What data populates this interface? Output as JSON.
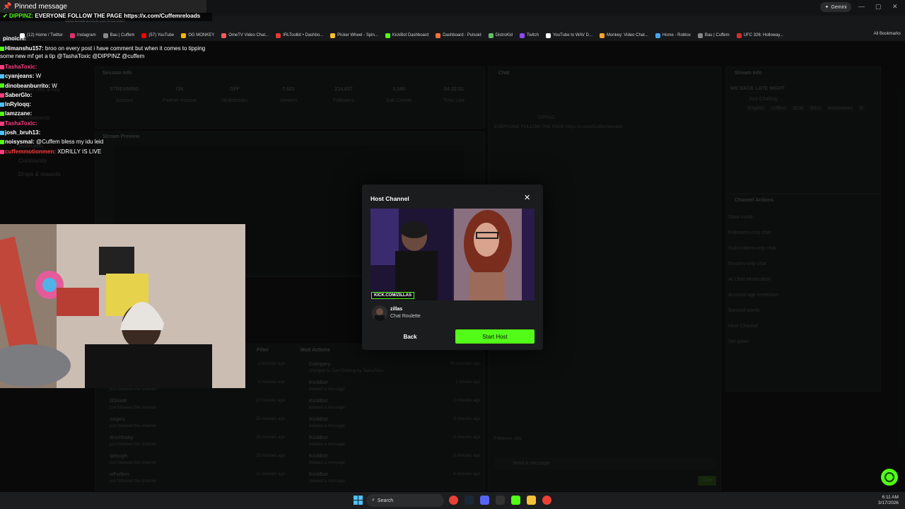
{
  "pinned": {
    "header": "Pinned message",
    "user": "DIPPINZ:",
    "text": "EVERYONE FOLLOW THE PAGE https://x.com/Cuffemreloads"
  },
  "browser": {
    "url": "dashboard.kick.com/stream",
    "gemini": "Gemini",
    "all_bookmarks": "All Bookmarks",
    "bookmarks": [
      {
        "label": "(12) Home / Twitter",
        "color": "#ffffff"
      },
      {
        "label": "Instagram",
        "color": "#e1306c"
      },
      {
        "label": "Bau | Cuffem",
        "color": "#888888"
      },
      {
        "label": "(57) YouTube",
        "color": "#ff0000"
      },
      {
        "label": "OG MONKEY",
        "color": "#ffb300"
      },
      {
        "label": "OmeTV Video Chat...",
        "color": "#ff5a5a"
      },
      {
        "label": "IRLToolkit • Dashbo...",
        "color": "#e53935"
      },
      {
        "label": "Picker Wheel - Spin...",
        "color": "#fbc02d"
      },
      {
        "label": "KickBot Dashboard",
        "color": "#53fc18"
      },
      {
        "label": "Dashboard - Pulsoid",
        "color": "#ff7043"
      },
      {
        "label": "DistroKid",
        "color": "#66bb6a"
      },
      {
        "label": "Twitch",
        "color": "#9146ff"
      },
      {
        "label": "YouTube to WAV D...",
        "color": "#ffffff"
      },
      {
        "label": "Monkey: Video Chat...",
        "color": "#ffa726"
      },
      {
        "label": "Home - Roblox",
        "color": "#42a5f5"
      },
      {
        "label": "Bau | Cuffem",
        "color": "#888888"
      },
      {
        "label": "UFC 326: Holloway...",
        "color": "#d32f2f"
      }
    ]
  },
  "chat_overlay": [
    {
      "user": "Himanshu157:",
      "color": "#ffffff",
      "text": "broo on every post i have comment but when it comes to tipping some new mf get a tip @TashaToxic @DIPPINZ @cuffem"
    },
    {
      "user": "TashaToxic:",
      "color": "#ff3b7f",
      "text": ""
    },
    {
      "user": "cyanjeans:",
      "color": "#ffffff",
      "text": "W"
    },
    {
      "user": "dinobeanburrito:",
      "color": "#ffffff",
      "text": "W"
    },
    {
      "user": "SaberGlo:",
      "color": "#ffffff",
      "text": ""
    },
    {
      "user": "lnRyloqq:",
      "color": "#ffffff",
      "text": ""
    },
    {
      "user": "lamzzane:",
      "color": "#ffffff",
      "text": ""
    },
    {
      "user": "TashaToxic:",
      "color": "#ff3b7f",
      "text": ""
    },
    {
      "user": "josh_bruh13:",
      "color": "#ffffff",
      "text": ""
    },
    {
      "user": "noisysmal:",
      "color": "#ffffff",
      "text": "@Cuffem bless my idu leid"
    },
    {
      "user": "cuffemmotionmen:",
      "color": "#ff3b3b",
      "text": "XDRILLY IS LIVE"
    }
  ],
  "chat_overlay_pinochi": "pinoichi:",
  "dashboard": {
    "session_info": "Session Info",
    "stream_preview": "Stream Preview",
    "chat_title": "Chat",
    "stream_info": "Stream Info",
    "stream_title": "WE BACK LATE NIGHT",
    "category": "Just Chatting",
    "tags": [
      "English",
      "cuffem",
      "BLM",
      "BAU",
      "motorrenes",
      "B"
    ],
    "stats": [
      {
        "value": "STREAMING",
        "label": "Session"
      },
      {
        "value": "ON",
        "label": "Partner Income"
      },
      {
        "value": "OFF",
        "label": "Multistream"
      },
      {
        "value": "7,623",
        "label": "Viewers"
      },
      {
        "value": "214,837",
        "label": "Followers"
      },
      {
        "value": "3,180",
        "label": "Sub Counts"
      },
      {
        "value": "04:22:01",
        "label": "Time Live"
      }
    ],
    "sidebar": [
      "Stream URL & Key",
      "Achievements",
      "Moderation",
      "Community",
      "Drops & rewards"
    ],
    "channel_actions_title": "Channel Actions",
    "channel_actions": [
      "Slow mode",
      "Followers-only chat",
      "Subscribers-only chat",
      "Emotes-only chat",
      "AI Chat Moderation",
      "Account age restriction",
      "Banned words",
      "Host Channel",
      "Set goals"
    ],
    "activity_title": "Filter",
    "mod_actions_title": "Mod Actions",
    "activity": [
      {
        "user": "",
        "action": "just followed the channel",
        "time": "2 minutes ago"
      },
      {
        "user": "",
        "action": "just followed the channel",
        "time": "8 minutes ago"
      },
      {
        "user": "l22ilaW",
        "action": "just followed the channel",
        "time": "12 minutes ago"
      },
      {
        "user": "sxipes",
        "action": "just followed the channel",
        "time": "15 minutes ago"
      },
      {
        "user": "drichbaby",
        "action": "just followed the channel",
        "time": "18 minutes ago"
      },
      {
        "user": "lplough",
        "action": "just followed the channel",
        "time": "20 minutes ago"
      },
      {
        "user": "wFwflen",
        "action": "just followed the channel",
        "time": "21 minutes ago"
      }
    ],
    "mod_actions": [
      {
        "user": "Category",
        "action": "changed to Just Chatting by TashaToxic",
        "time": "40 seconds ago"
      },
      {
        "user": "KickBot",
        "action": "deleted a message",
        "time": "1 minute ago"
      },
      {
        "user": "KickBot",
        "action": "deleted a message",
        "time": "2 minutes ago"
      },
      {
        "user": "KickBot",
        "action": "deleted a message",
        "time": "3 minutes ago"
      },
      {
        "user": "KickBot",
        "action": "deleted a message",
        "time": "4 minutes ago"
      },
      {
        "user": "KickBot",
        "action": "deleted a message",
        "time": "5 minutes ago"
      },
      {
        "user": "KickBot",
        "action": "deleted a message",
        "time": "6 minutes ago"
      }
    ],
    "chat_pinned_user": "DIPPINZ",
    "chat_pinned_text": "EVERYONE FOLLOW THE PAGE https://x.com/Cuffemreloads",
    "chat_input_placeholder": "Send a message",
    "chat_send": "Chat",
    "followers_only": "Followers only"
  },
  "modal": {
    "title": "Host Channel",
    "channel_name": "zillas",
    "channel_category": "Chat Roulette",
    "thumb_label": "KICK.COM/ZILLAS",
    "back_label": "Back",
    "start_label": "Start Host"
  },
  "taskbar": {
    "search": "Search",
    "time": "6:11 AM",
    "date": "3/17/2026"
  }
}
